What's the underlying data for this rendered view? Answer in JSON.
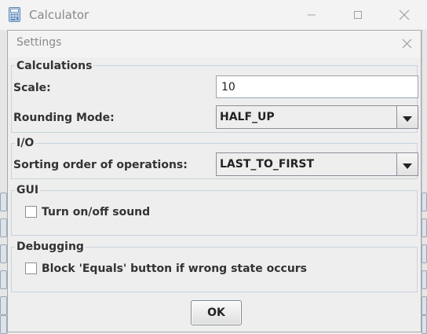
{
  "main_window": {
    "title": "Calculator"
  },
  "settings": {
    "title": "Settings",
    "calculations": {
      "group_title": "Calculations",
      "scale_label": "Scale:",
      "scale_value": "10",
      "rounding_label": "Rounding Mode:",
      "rounding_value": "HALF_UP"
    },
    "io": {
      "group_title": "I/O",
      "sorting_label": "Sorting order of operations:",
      "sorting_value": "LAST_TO_FIRST"
    },
    "gui": {
      "group_title": "GUI",
      "sound_label": "Turn on/off sound",
      "sound_checked": false
    },
    "debugging": {
      "group_title": "Debugging",
      "block_equals_label": "Block 'Equals' button if wrong state occurs",
      "block_equals_checked": false
    },
    "ok_label": "OK"
  },
  "icons": {
    "app": "calculator-icon",
    "minimize": "minimize-icon",
    "maximize": "maximize-icon",
    "close": "close-icon",
    "dropdown": "chevron-down-icon"
  }
}
